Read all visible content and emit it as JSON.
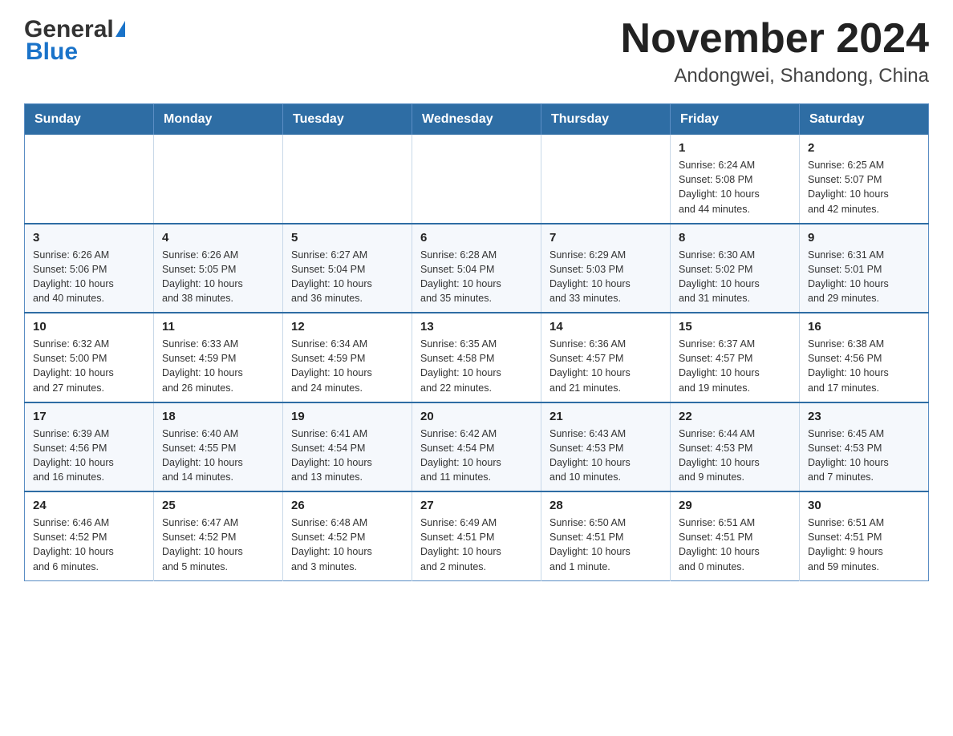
{
  "header": {
    "logo_general": "General",
    "logo_blue": "Blue",
    "title": "November 2024",
    "subtitle": "Andongwei, Shandong, China"
  },
  "days_of_week": [
    "Sunday",
    "Monday",
    "Tuesday",
    "Wednesday",
    "Thursday",
    "Friday",
    "Saturday"
  ],
  "weeks": [
    [
      {
        "day": "",
        "info": ""
      },
      {
        "day": "",
        "info": ""
      },
      {
        "day": "",
        "info": ""
      },
      {
        "day": "",
        "info": ""
      },
      {
        "day": "",
        "info": ""
      },
      {
        "day": "1",
        "info": "Sunrise: 6:24 AM\nSunset: 5:08 PM\nDaylight: 10 hours\nand 44 minutes."
      },
      {
        "day": "2",
        "info": "Sunrise: 6:25 AM\nSunset: 5:07 PM\nDaylight: 10 hours\nand 42 minutes."
      }
    ],
    [
      {
        "day": "3",
        "info": "Sunrise: 6:26 AM\nSunset: 5:06 PM\nDaylight: 10 hours\nand 40 minutes."
      },
      {
        "day": "4",
        "info": "Sunrise: 6:26 AM\nSunset: 5:05 PM\nDaylight: 10 hours\nand 38 minutes."
      },
      {
        "day": "5",
        "info": "Sunrise: 6:27 AM\nSunset: 5:04 PM\nDaylight: 10 hours\nand 36 minutes."
      },
      {
        "day": "6",
        "info": "Sunrise: 6:28 AM\nSunset: 5:04 PM\nDaylight: 10 hours\nand 35 minutes."
      },
      {
        "day": "7",
        "info": "Sunrise: 6:29 AM\nSunset: 5:03 PM\nDaylight: 10 hours\nand 33 minutes."
      },
      {
        "day": "8",
        "info": "Sunrise: 6:30 AM\nSunset: 5:02 PM\nDaylight: 10 hours\nand 31 minutes."
      },
      {
        "day": "9",
        "info": "Sunrise: 6:31 AM\nSunset: 5:01 PM\nDaylight: 10 hours\nand 29 minutes."
      }
    ],
    [
      {
        "day": "10",
        "info": "Sunrise: 6:32 AM\nSunset: 5:00 PM\nDaylight: 10 hours\nand 27 minutes."
      },
      {
        "day": "11",
        "info": "Sunrise: 6:33 AM\nSunset: 4:59 PM\nDaylight: 10 hours\nand 26 minutes."
      },
      {
        "day": "12",
        "info": "Sunrise: 6:34 AM\nSunset: 4:59 PM\nDaylight: 10 hours\nand 24 minutes."
      },
      {
        "day": "13",
        "info": "Sunrise: 6:35 AM\nSunset: 4:58 PM\nDaylight: 10 hours\nand 22 minutes."
      },
      {
        "day": "14",
        "info": "Sunrise: 6:36 AM\nSunset: 4:57 PM\nDaylight: 10 hours\nand 21 minutes."
      },
      {
        "day": "15",
        "info": "Sunrise: 6:37 AM\nSunset: 4:57 PM\nDaylight: 10 hours\nand 19 minutes."
      },
      {
        "day": "16",
        "info": "Sunrise: 6:38 AM\nSunset: 4:56 PM\nDaylight: 10 hours\nand 17 minutes."
      }
    ],
    [
      {
        "day": "17",
        "info": "Sunrise: 6:39 AM\nSunset: 4:56 PM\nDaylight: 10 hours\nand 16 minutes."
      },
      {
        "day": "18",
        "info": "Sunrise: 6:40 AM\nSunset: 4:55 PM\nDaylight: 10 hours\nand 14 minutes."
      },
      {
        "day": "19",
        "info": "Sunrise: 6:41 AM\nSunset: 4:54 PM\nDaylight: 10 hours\nand 13 minutes."
      },
      {
        "day": "20",
        "info": "Sunrise: 6:42 AM\nSunset: 4:54 PM\nDaylight: 10 hours\nand 11 minutes."
      },
      {
        "day": "21",
        "info": "Sunrise: 6:43 AM\nSunset: 4:53 PM\nDaylight: 10 hours\nand 10 minutes."
      },
      {
        "day": "22",
        "info": "Sunrise: 6:44 AM\nSunset: 4:53 PM\nDaylight: 10 hours\nand 9 minutes."
      },
      {
        "day": "23",
        "info": "Sunrise: 6:45 AM\nSunset: 4:53 PM\nDaylight: 10 hours\nand 7 minutes."
      }
    ],
    [
      {
        "day": "24",
        "info": "Sunrise: 6:46 AM\nSunset: 4:52 PM\nDaylight: 10 hours\nand 6 minutes."
      },
      {
        "day": "25",
        "info": "Sunrise: 6:47 AM\nSunset: 4:52 PM\nDaylight: 10 hours\nand 5 minutes."
      },
      {
        "day": "26",
        "info": "Sunrise: 6:48 AM\nSunset: 4:52 PM\nDaylight: 10 hours\nand 3 minutes."
      },
      {
        "day": "27",
        "info": "Sunrise: 6:49 AM\nSunset: 4:51 PM\nDaylight: 10 hours\nand 2 minutes."
      },
      {
        "day": "28",
        "info": "Sunrise: 6:50 AM\nSunset: 4:51 PM\nDaylight: 10 hours\nand 1 minute."
      },
      {
        "day": "29",
        "info": "Sunrise: 6:51 AM\nSunset: 4:51 PM\nDaylight: 10 hours\nand 0 minutes."
      },
      {
        "day": "30",
        "info": "Sunrise: 6:51 AM\nSunset: 4:51 PM\nDaylight: 9 hours\nand 59 minutes."
      }
    ]
  ]
}
